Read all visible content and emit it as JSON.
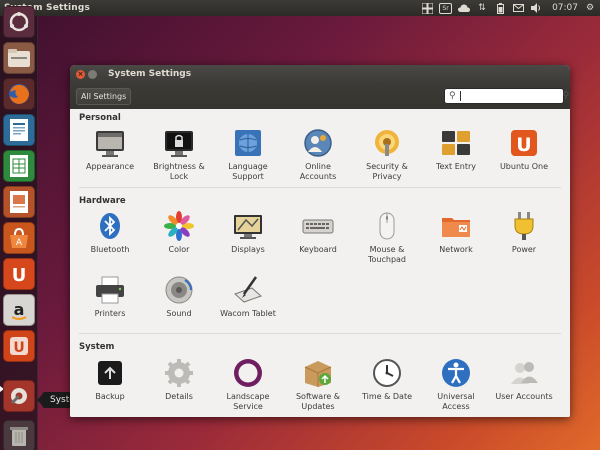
{
  "panel": {
    "title": "System Settings",
    "clock": "07:07",
    "keyboard_layout": "Sr"
  },
  "launcher": {
    "tooltip": "System Settings",
    "items": [
      {
        "name": "ubuntu-dash"
      },
      {
        "name": "files"
      },
      {
        "name": "firefox"
      },
      {
        "name": "libreoffice-writer"
      },
      {
        "name": "libreoffice-calc"
      },
      {
        "name": "libreoffice-impress"
      },
      {
        "name": "ubuntu-software-center"
      },
      {
        "name": "ubuntu-one"
      },
      {
        "name": "amazon"
      },
      {
        "name": "ubuntu-one-music"
      },
      {
        "name": "system-settings"
      },
      {
        "name": "trash"
      }
    ]
  },
  "window": {
    "title": "System Settings",
    "all_settings_label": "All Settings",
    "search": {
      "value": "",
      "placeholder": ""
    }
  },
  "sections": {
    "personal": {
      "title": "Personal",
      "items": [
        {
          "label": "Appearance",
          "icon": "appearance-icon"
        },
        {
          "label": "Brightness &\nLock",
          "icon": "brightness-lock-icon"
        },
        {
          "label": "Language\nSupport",
          "icon": "language-support-icon"
        },
        {
          "label": "Online\nAccounts",
          "icon": "online-accounts-icon"
        },
        {
          "label": "Security &\nPrivacy",
          "icon": "security-privacy-icon"
        },
        {
          "label": "Text Entry",
          "icon": "text-entry-icon"
        },
        {
          "label": "Ubuntu One",
          "icon": "ubuntu-one-icon"
        }
      ]
    },
    "hardware": {
      "title": "Hardware",
      "items": [
        {
          "label": "Bluetooth",
          "icon": "bluetooth-icon"
        },
        {
          "label": "Color",
          "icon": "color-icon"
        },
        {
          "label": "Displays",
          "icon": "displays-icon"
        },
        {
          "label": "Keyboard",
          "icon": "keyboard-icon"
        },
        {
          "label": "Mouse &\nTouchpad",
          "icon": "mouse-touchpad-icon"
        },
        {
          "label": "Network",
          "icon": "network-icon"
        },
        {
          "label": "Power",
          "icon": "power-icon"
        },
        {
          "label": "Printers",
          "icon": "printers-icon"
        },
        {
          "label": "Sound",
          "icon": "sound-icon"
        },
        {
          "label": "Wacom Tablet",
          "icon": "wacom-tablet-icon"
        }
      ]
    },
    "system": {
      "title": "System",
      "items": [
        {
          "label": "Backup",
          "icon": "backup-icon"
        },
        {
          "label": "Details",
          "icon": "details-icon"
        },
        {
          "label": "Landscape\nService",
          "icon": "landscape-service-icon"
        },
        {
          "label": "Software &\nUpdates",
          "icon": "software-updates-icon"
        },
        {
          "label": "Time & Date",
          "icon": "time-date-icon"
        },
        {
          "label": "Universal\nAccess",
          "icon": "universal-access-icon"
        },
        {
          "label": "User Accounts",
          "icon": "user-accounts-icon"
        }
      ]
    }
  },
  "colors": {
    "accent": "#e05b35",
    "panel_bg": "#3c3b37",
    "window_bg": "#f2f1f0"
  }
}
